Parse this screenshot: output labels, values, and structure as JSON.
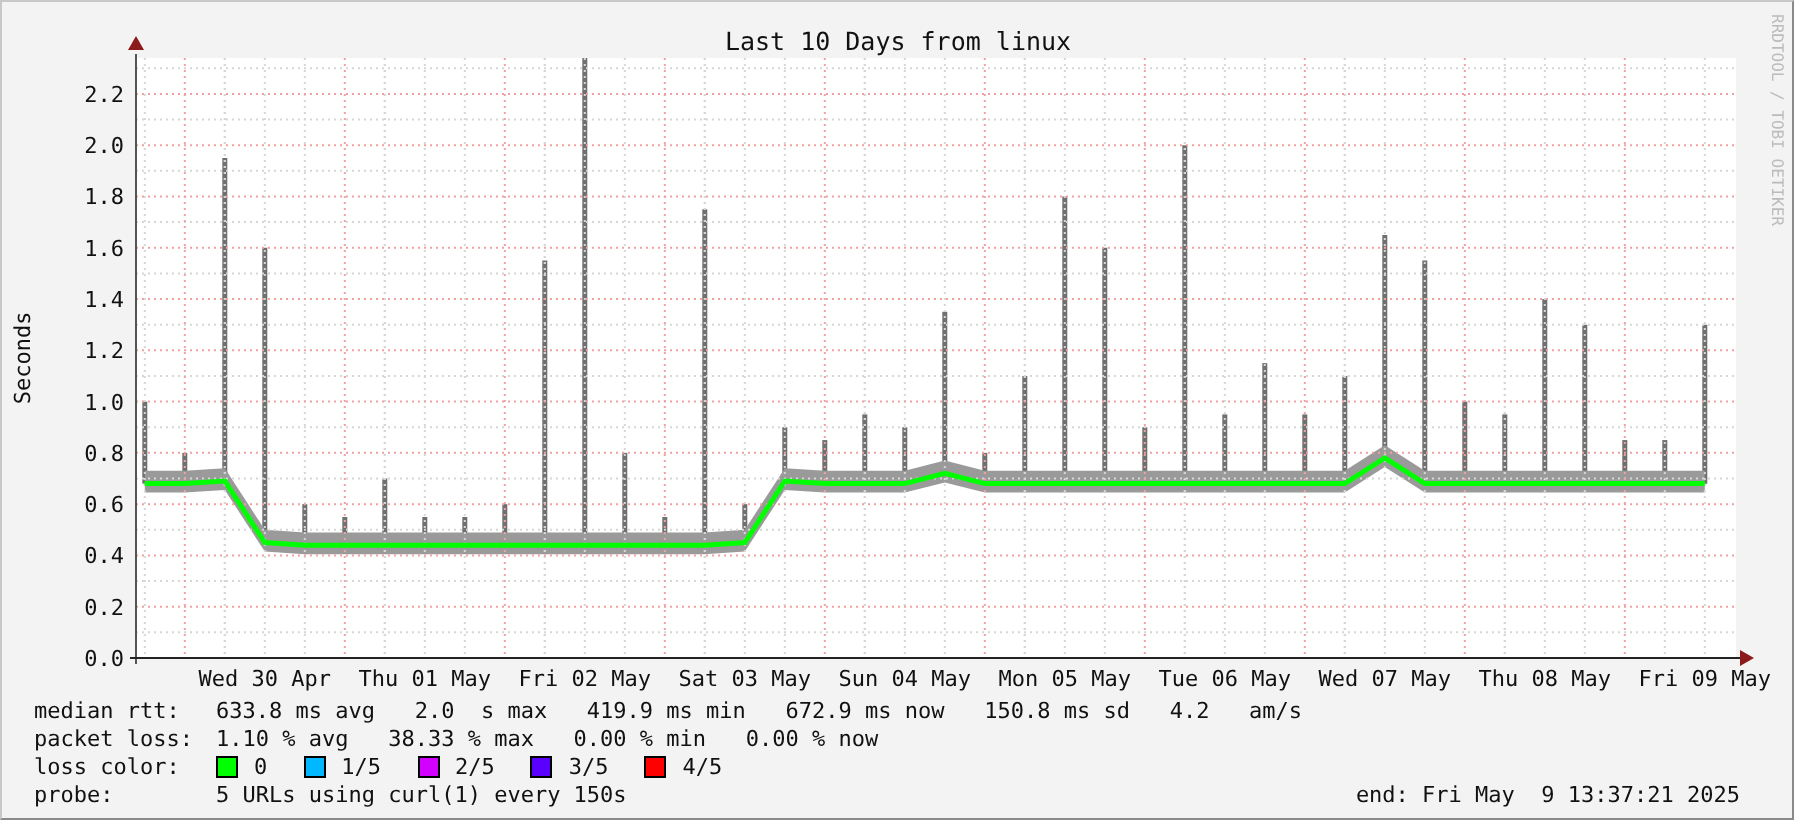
{
  "chart_data": {
    "type": "line",
    "title": "Last 10 Days from linux",
    "ylabel": "Seconds",
    "ylim": [
      0,
      2.34
    ],
    "grid": true,
    "categories": [
      null,
      null,
      null,
      "Wed 30 Apr",
      null,
      null,
      null,
      "Thu 01 May",
      null,
      null,
      null,
      "Fri 02 May",
      null,
      null,
      null,
      "Sat 03 May",
      null,
      null,
      null,
      "Sun 04 May",
      null,
      null,
      null,
      "Mon 05 May",
      null,
      null,
      null,
      "Tue 06 May",
      null,
      null,
      null,
      "Wed 07 May",
      null,
      null,
      null,
      "Thu 08 May",
      null,
      null,
      null,
      "Fri 09 May"
    ],
    "series": [
      {
        "color": "#00ff00",
        "values": [
          0.68,
          0.68,
          0.69,
          0.45,
          0.44,
          0.44,
          0.44,
          0.44,
          0.44,
          0.44,
          0.44,
          0.44,
          0.44,
          0.44,
          0.44,
          0.45,
          0.69,
          0.68,
          0.68,
          0.68,
          0.72,
          0.68,
          0.68,
          0.68,
          0.68,
          0.68,
          0.68,
          0.68,
          0.68,
          0.68,
          0.68,
          0.78,
          0.68,
          0.68,
          0.68,
          0.68,
          0.68,
          0.68,
          0.68,
          0.68
        ]
      }
    ],
    "yticks": [
      {
        "value": 0,
        "label": "0.0"
      },
      {
        "value": 0.2,
        "label": "0.2"
      },
      {
        "value": 0.4,
        "label": "0.4"
      },
      {
        "value": 0.6,
        "label": "0.6"
      },
      {
        "value": 0.8,
        "label": "0.8"
      },
      {
        "value": 1.0,
        "label": "1.0"
      },
      {
        "value": 1.2,
        "label": "1.2"
      },
      {
        "value": 1.4,
        "label": "1.4"
      },
      {
        "value": 1.6,
        "label": "1.6"
      },
      {
        "value": 1.8,
        "label": "1.8"
      },
      {
        "value": 2.0,
        "label": "2.0"
      },
      {
        "value": 2.2,
        "label": "2.2"
      }
    ]
  },
  "credit": "RRDTOOL / TOBI OETIKER",
  "legend": [
    {
      "label": "median rtt:",
      "value": "633.8 ms avg   2.0  s max   419.9 ms min   672.9 ms now   150.8 ms sd   4.2   am/s"
    },
    {
      "label": "packet loss:",
      "value": "1.10 % avg   38.33 % max   0.00 % min   0.00 % now"
    }
  ],
  "loss_colors": {
    "label": "loss color:",
    "items": [
      {
        "label": "0",
        "color": "#00ff00"
      },
      {
        "label": "1/5",
        "color": "#00b8ff"
      },
      {
        "label": "2/5",
        "color": "#d200ff"
      },
      {
        "label": "3/5",
        "color": "#5a00ff"
      },
      {
        "label": "4/5",
        "color": "#ff0000"
      }
    ]
  },
  "probe": {
    "label": "probe:",
    "value": "5 URLs using curl(1) every 150s",
    "end": "end: Fri May  9 13:37:21 2025"
  }
}
